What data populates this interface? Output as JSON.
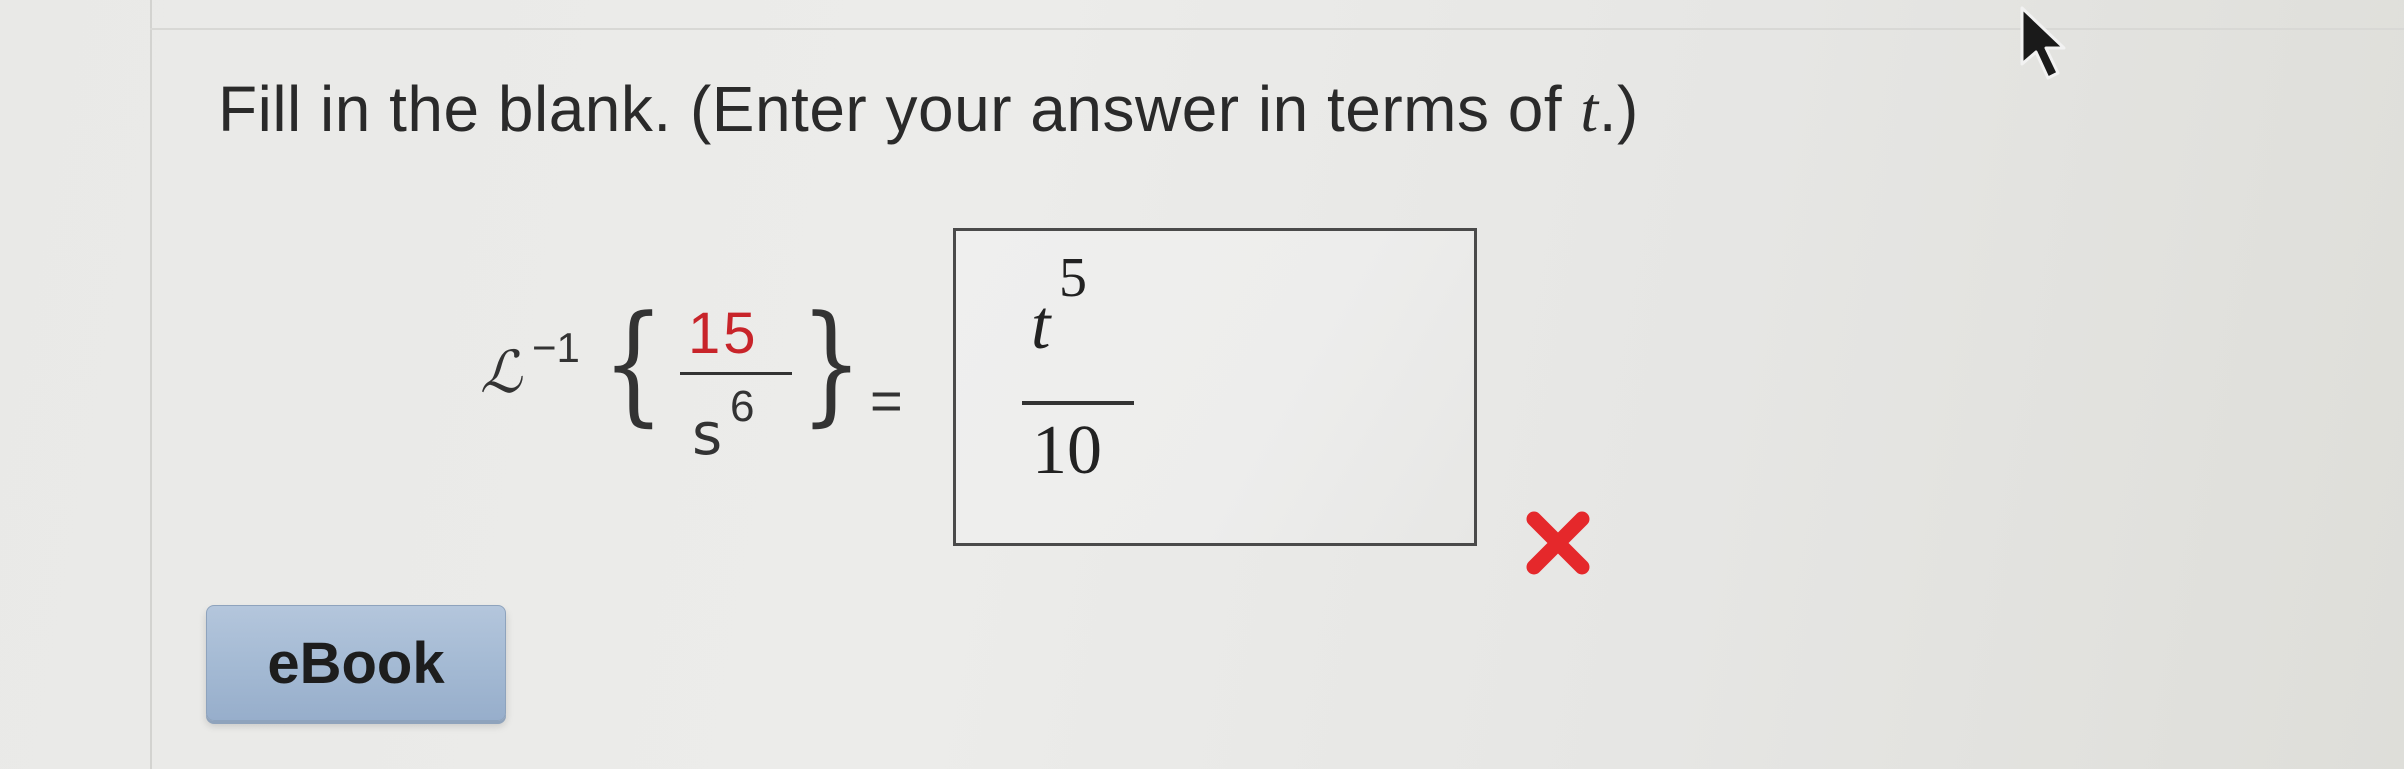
{
  "question": {
    "prompt_text": "Fill in the blank. (Enter your answer in terms of ",
    "prompt_variable": "t",
    "prompt_end": ".)"
  },
  "expression": {
    "operator": "ℒ",
    "operator_exponent": "−1",
    "brace_open": "{",
    "brace_close": "}",
    "numerator": "15",
    "denominator_base": "s",
    "denominator_exponent": "6",
    "equals": "="
  },
  "answer": {
    "numerator_base": "t",
    "numerator_exponent": "5",
    "denominator": "10",
    "status": "incorrect"
  },
  "buttons": {
    "ebook_label": "eBook"
  },
  "colors": {
    "numerator_red": "#c8242a",
    "incorrect_mark": "#e5282b",
    "button_blue": "#a3b9d3"
  },
  "icons": {
    "status_icon": "incorrect-x-icon",
    "cursor_icon": "mouse-pointer-icon"
  }
}
